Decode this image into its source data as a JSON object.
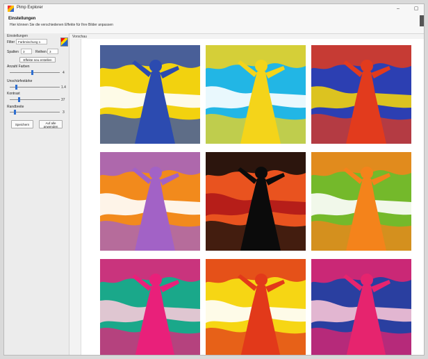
{
  "window": {
    "title": "Pimp Explorer"
  },
  "header": {
    "title": "Einstellungen",
    "subtitle": "Hier können Sie die verschiedenen Effekte für Ihre Bilder anpassen"
  },
  "sidebar": {
    "section_label": "Einstellungen",
    "filter_label": "Filter",
    "filter_value": "Farbmischung 1",
    "columns_label": "Spalten",
    "columns_value": "3",
    "rows_label": "Reihen",
    "rows_value": "3",
    "recreate_button": "Effekte neu erstellen",
    "colors_label": "Anzahl Farben",
    "colors_value": "4",
    "colors_level": 0.45,
    "blur_label": "Unschärfestärke",
    "blur_value": "1.4",
    "blur_level": 0.12,
    "contrast_label": "Kontrast",
    "contrast_value": "37",
    "contrast_level": 0.18,
    "brightness_label": "Randbreite",
    "brightness_value": "3",
    "brightness_level": 0.1,
    "save_button": "Speichern",
    "reset_button": "Auf alle anwenden"
  },
  "preview": {
    "label": "Vorschau"
  },
  "tiles": [
    {
      "bg": "#f2d20f",
      "fg": "#2c4bb0",
      "ac": "#ffffff"
    },
    {
      "bg": "#22b6e5",
      "fg": "#f4d41a",
      "ac": "#ffffff"
    },
    {
      "bg": "#2c3fb2",
      "fg": "#e23b1d",
      "ac": "#f0d20f"
    },
    {
      "bg": "#f28a1c",
      "fg": "#a262c6",
      "ac": "#ffffff"
    },
    {
      "bg": "#e9531f",
      "fg": "#0b0b0b",
      "ac": "#b01818"
    },
    {
      "bg": "#74b92b",
      "fg": "#f4831b",
      "ac": "#ffffff"
    },
    {
      "bg": "#1aa88a",
      "fg": "#e9207a",
      "ac": "#f5c9d8"
    },
    {
      "bg": "#f6d614",
      "fg": "#e2391a",
      "ac": "#ffffff"
    },
    {
      "bg": "#2a3fa0",
      "fg": "#e6246e",
      "ac": "#f6c3d6"
    }
  ]
}
